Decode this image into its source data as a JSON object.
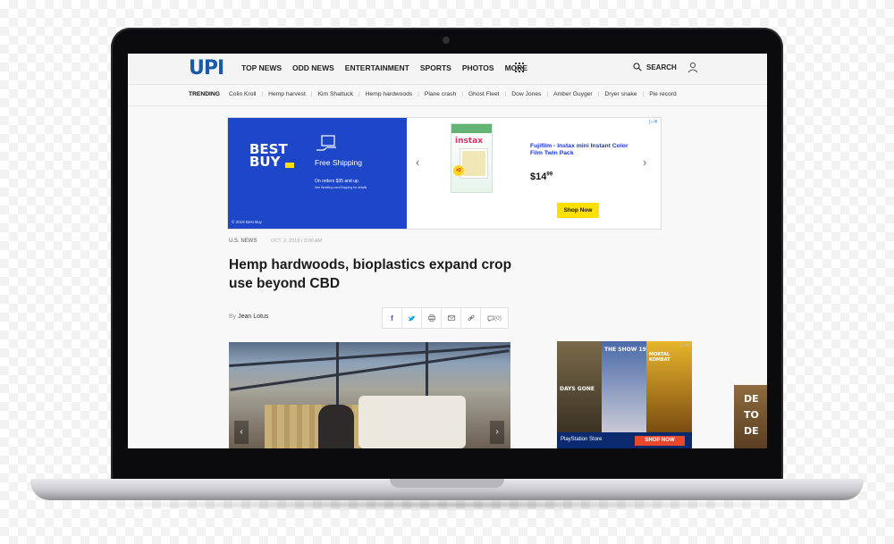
{
  "nav": {
    "logo": "UPI",
    "links": [
      "TOP NEWS",
      "ODD NEWS",
      "ENTERTAINMENT",
      "SPORTS",
      "PHOTOS",
      "MORE"
    ],
    "search_label": "SEARCH"
  },
  "trending": {
    "label": "TRENDING",
    "items": [
      "Colin Kroll",
      "Hemp harvest",
      "Kim Shattuck",
      "Hemp hardwoods",
      "Plane crash",
      "Ghost Fleet",
      "Dow Jones",
      "Amber Guyger",
      "Dryer snake",
      "Pie record"
    ]
  },
  "ad": {
    "brand": "BEST BUY",
    "free_shipping": "Free Shipping",
    "orders": "On orders $35 and up.",
    "fine_print": "See BestBuy.com/Shipping for details",
    "copyright": "© 2019 Best Buy",
    "product_box": "instax",
    "product_title": "Fujifilm - Instax mini Instant Color Film Twin Pack",
    "price_main": "$14",
    "price_cents": "99",
    "cta": "Shop Now",
    "adchoices": "▷✕"
  },
  "article": {
    "category": "U.S. NEWS",
    "date": "OCT. 2, 2019 / 3:00 AM",
    "headline": "Hemp hardwoods, bioplastics expand crop use beyond CBD",
    "by": "By",
    "author": "Jean Lotus",
    "comments": "(0)"
  },
  "side_ad": {
    "games": [
      "DAYS GONE",
      "THE SHOW 19",
      "MORTAL KOMBAT"
    ],
    "store": "PlayStation Store",
    "cta": "SHOP NOW",
    "adchoices": "▷✕"
  },
  "side_peek": {
    "lines": [
      "DE",
      "TO",
      "DE"
    ]
  },
  "colors": {
    "upi_blue": "#1a5aa8",
    "bestbuy_blue": "#1e46c9",
    "bestbuy_yellow": "#ffe000",
    "ps_red": "#e8482c"
  }
}
